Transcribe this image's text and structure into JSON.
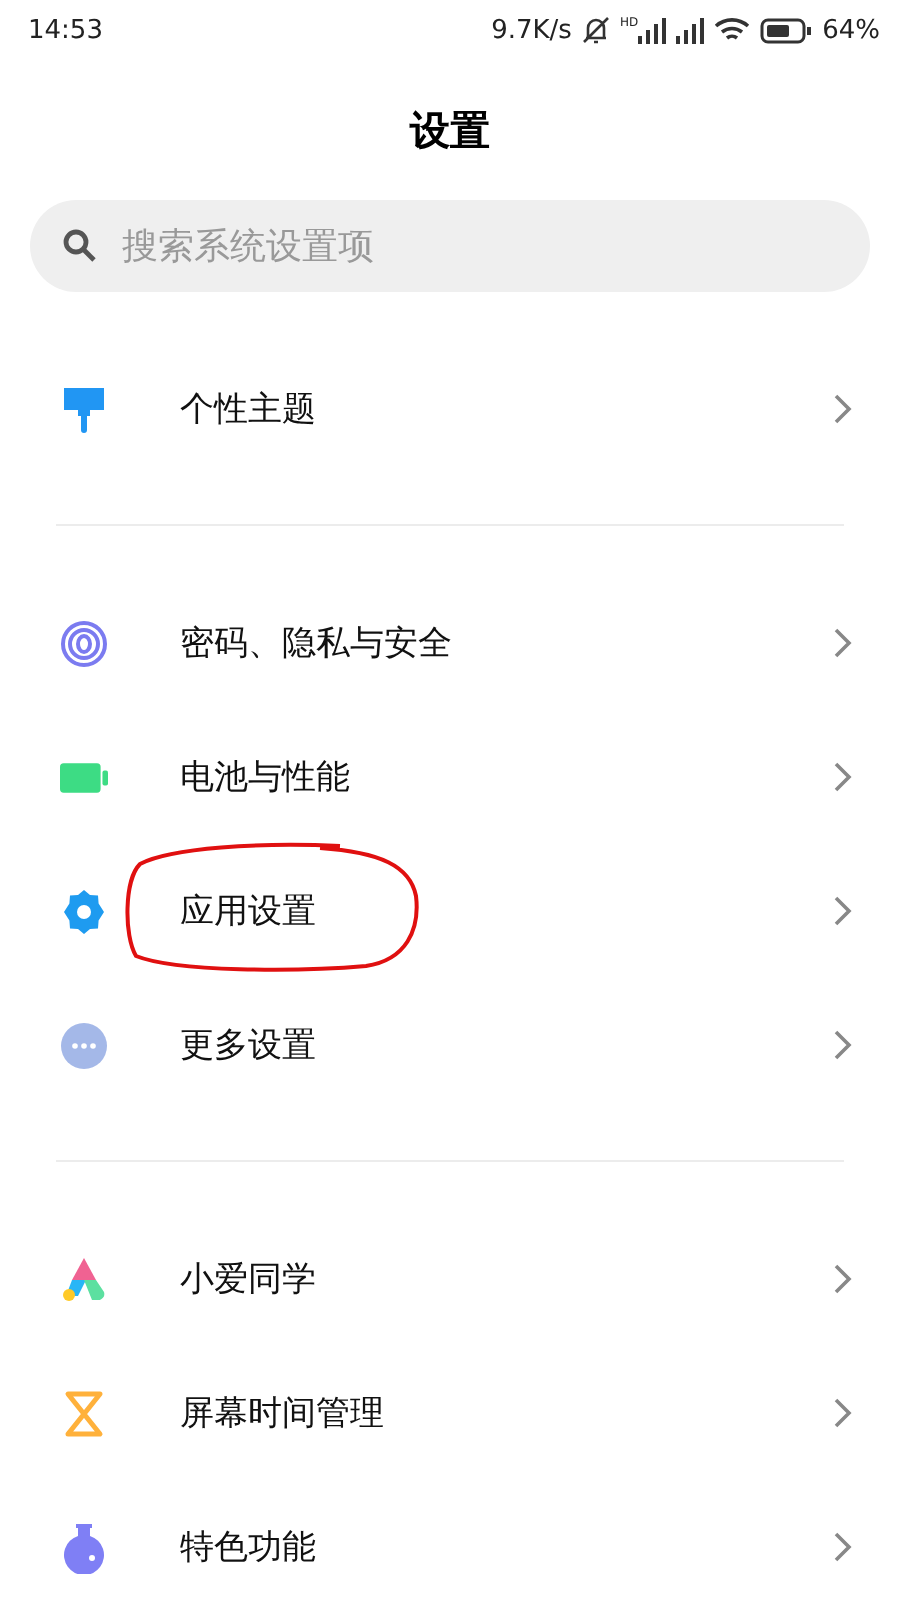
{
  "status_bar": {
    "time": "14:53",
    "speed": "9.7K/s",
    "battery_percent": "64%",
    "signal_tag": "HD"
  },
  "title": "设置",
  "search": {
    "placeholder": "搜索系统设置项"
  },
  "groups": [
    {
      "items": [
        {
          "kind": "brush",
          "label": "个性主题",
          "circled": false
        }
      ]
    },
    {
      "items": [
        {
          "kind": "fingerprint",
          "label": "密码、隐私与安全",
          "circled": false
        },
        {
          "kind": "battery",
          "label": "电池与性能",
          "circled": false
        },
        {
          "kind": "gear",
          "label": "应用设置",
          "circled": true
        },
        {
          "kind": "more",
          "label": "更多设置",
          "circled": false
        }
      ]
    },
    {
      "items": [
        {
          "kind": "assistant",
          "label": "小爱同学",
          "circled": false
        },
        {
          "kind": "hourglass",
          "label": "屏幕时间管理",
          "circled": false
        },
        {
          "kind": "flask",
          "label": "特色功能",
          "circled": false
        }
      ]
    }
  ]
}
